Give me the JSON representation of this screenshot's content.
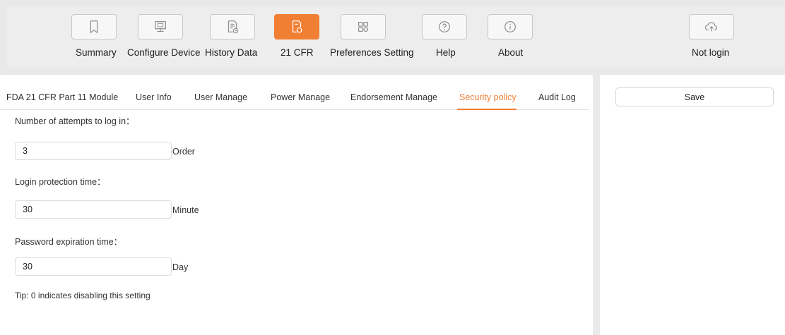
{
  "toolbar": {
    "items": [
      {
        "label": "Summary",
        "icon": "bookmark-icon",
        "active": false
      },
      {
        "label": "Configure Device",
        "icon": "monitor-icon",
        "active": false
      },
      {
        "label": "History Data",
        "icon": "document-clock-icon",
        "active": false
      },
      {
        "label": "21 CFR",
        "icon": "document-shield-icon",
        "active": true
      },
      {
        "label": "Preferences Setting",
        "icon": "grid-icon",
        "active": false
      },
      {
        "label": "Help",
        "icon": "question-circle-icon",
        "active": false
      },
      {
        "label": "About",
        "icon": "info-circle-icon",
        "active": false
      }
    ],
    "login": {
      "label": "Not login",
      "icon": "cloud-upload-icon"
    }
  },
  "tabs": [
    {
      "label": "FDA 21 CFR Part 11 Module",
      "active": false
    },
    {
      "label": "User Info",
      "active": false
    },
    {
      "label": "User Manage",
      "active": false
    },
    {
      "label": "Power Manage",
      "active": false
    },
    {
      "label": "Endorsement Manage",
      "active": false
    },
    {
      "label": "Security policy",
      "active": true
    },
    {
      "label": "Audit Log",
      "active": false
    }
  ],
  "form": {
    "attempts": {
      "label": "Number of attempts to log in：",
      "value": "3",
      "unit": "Order"
    },
    "protection": {
      "label": "Login protection time：",
      "value": "30",
      "unit": "Minute"
    },
    "expiration": {
      "label": "Password expiration time：",
      "value": "30",
      "unit": "Day"
    },
    "tip": "Tip: 0 indicates disabling this setting"
  },
  "right": {
    "save_label": "Save"
  },
  "colors": {
    "accent": "#f07f34",
    "toolbar_bg": "#ededed",
    "page_bg": "#e9e9e9"
  }
}
